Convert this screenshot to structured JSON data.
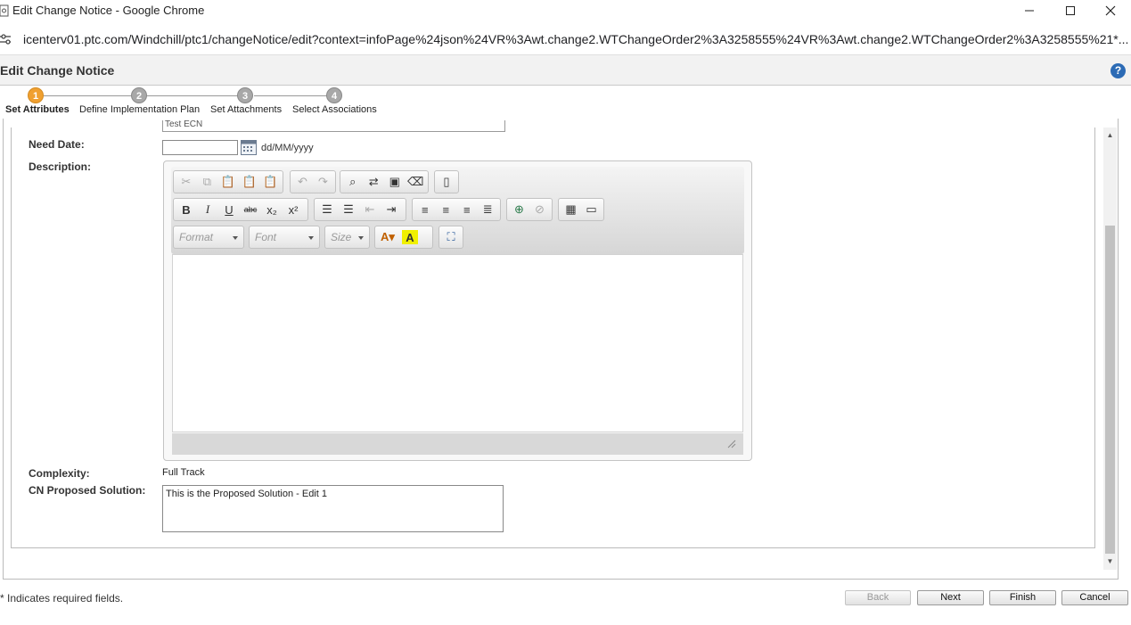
{
  "window": {
    "title": "Edit Change Notice - Google Chrome",
    "url": "icenterv01.ptc.com/Windchill/ptc1/changeNotice/edit?context=infoPage%24json%24VR%3Awt.change2.WTChangeOrder2%3A3258555%24VR%3Awt.change2.WTChangeOrder2%3A3258555%21*..."
  },
  "dialog": {
    "title": "Edit Change Notice",
    "help_glyph": "?"
  },
  "steps": [
    {
      "number": "1",
      "label": "Set Attributes",
      "active": true
    },
    {
      "number": "2",
      "label": "Define Implementation Plan",
      "active": false
    },
    {
      "number": "3",
      "label": "Set Attachments",
      "active": false
    },
    {
      "number": "4",
      "label": "Select Associations",
      "active": false
    }
  ],
  "form": {
    "cut_field_value": "Test ECN",
    "need_date": {
      "label": "Need Date:",
      "value": "",
      "format_hint": "dd/MM/yyyy"
    },
    "description": {
      "label": "Description:",
      "content": "",
      "toolbar": {
        "format_placeholder": "Format",
        "font_placeholder": "Font",
        "size_placeholder": "Size"
      }
    },
    "complexity": {
      "label": "Complexity:",
      "value": "Full Track"
    },
    "proposed_solution": {
      "label": "CN Proposed Solution:",
      "value": "This is the Proposed Solution - Edit 1"
    }
  },
  "footer": {
    "required_note": "* Indicates required fields.",
    "buttons": {
      "back": "Back",
      "next": "Next",
      "finish": "Finish",
      "cancel": "Cancel"
    }
  },
  "colors": {
    "active_step": "#f0a030",
    "inactive_step": "#a8a8a8",
    "help_icon": "#2c6bb5"
  }
}
